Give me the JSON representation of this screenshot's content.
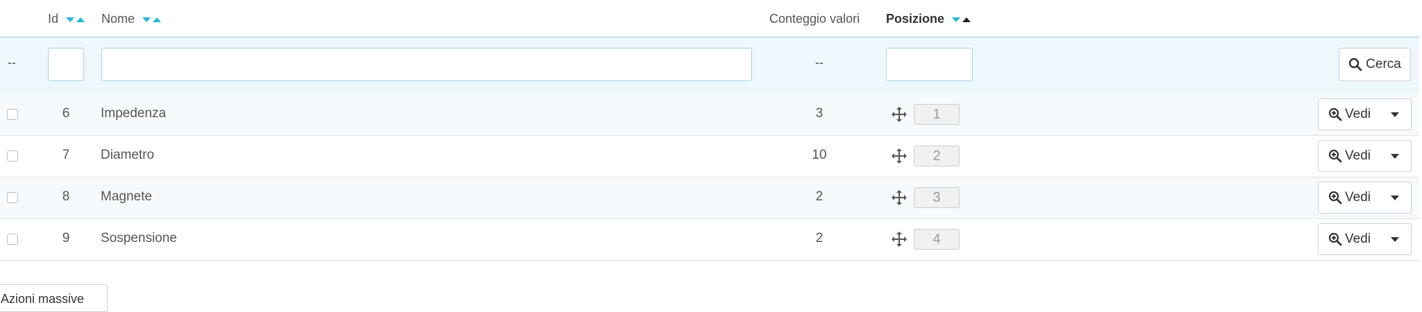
{
  "header": {
    "id_label": "Id",
    "name_label": "Nome",
    "count_label": "Conteggio valori",
    "position_label": "Posizione"
  },
  "filters": {
    "checkbox_placeholder": "--",
    "id_value": "",
    "name_value": "",
    "count_placeholder": "--",
    "position_value": "",
    "search_label": "Cerca"
  },
  "rows": [
    {
      "id": "6",
      "name": "Impedenza",
      "count": "3",
      "position": "1",
      "action": "Vedi"
    },
    {
      "id": "7",
      "name": "Diametro",
      "count": "10",
      "position": "2",
      "action": "Vedi"
    },
    {
      "id": "8",
      "name": "Magnete",
      "count": "2",
      "position": "3",
      "action": "Vedi"
    },
    {
      "id": "9",
      "name": "Sospensione",
      "count": "2",
      "position": "4",
      "action": "Vedi"
    }
  ],
  "bulk_actions_label": "Azioni massive",
  "colors": {
    "accent": "#25b9d7",
    "filter_bg": "#eef7fb"
  },
  "icons": [
    "caret-down-icon",
    "caret-up-icon",
    "search-icon",
    "zoom-in-icon",
    "move-icon"
  ]
}
